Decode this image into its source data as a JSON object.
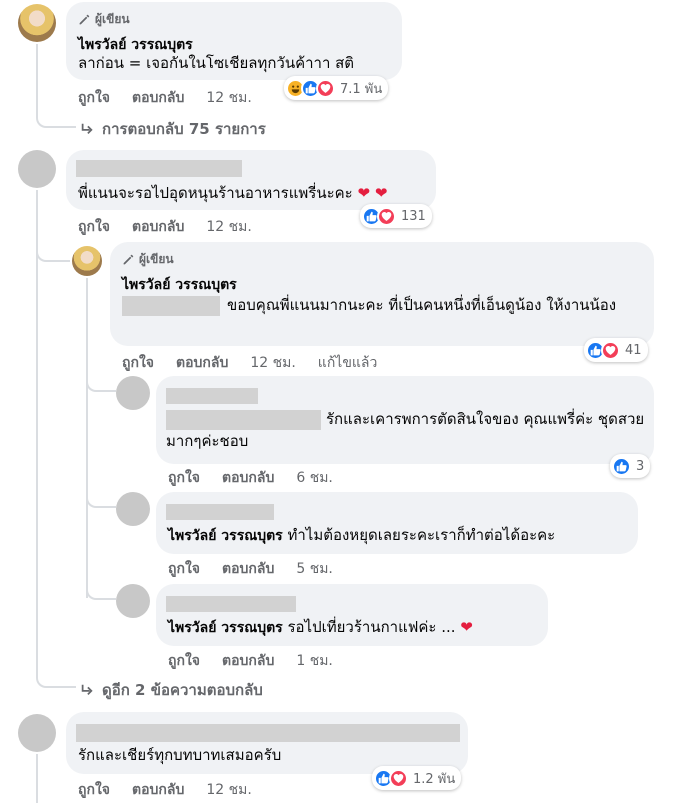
{
  "author_tag": "ผู้เขียน",
  "actions": {
    "like": "ถูกใจ",
    "reply": "ตอบกลับ",
    "edited": "แก้ไขแล้ว"
  },
  "comments": [
    {
      "name": "ไพรวัลย์ วรรณบุตร",
      "text": "ลาก่อน = เจอกันในโซเชียลทุกวันค้าาา สติ",
      "time": "12 ชม.",
      "reaction_count": "7.1 พัน",
      "replies_link": "การตอบกลับ 75 รายการ"
    },
    {
      "text": "พี่แนนจะรอไปอุดหนุนร้านอาหารแพรี่นะคะ",
      "time": "12 ชม.",
      "reaction_count": "131",
      "replies": [
        {
          "name": "ไพรวัลย์ วรรณบุตร",
          "text": "ขอบคุณพี่แนนมากนะคะ ที่เป็นคนหนึ่งที่เอ็นดูน้อง ให้งานน้อง",
          "time": "12 ชม.",
          "reaction_count": "41"
        },
        {
          "text": "รักและเคารพการตัดสินใจของ คุณแพรี่ค่ะ ชุดสวยมากๆค่ะชอบ",
          "time": "6 ชม.",
          "reaction_count": "3"
        },
        {
          "tagged_name": "ไพรวัลย์ วรรณบุตร",
          "text": "ทำไมต้องหยุดเลยระคะเราก็ทำต่อได้อะคะ",
          "time": "5 ชม."
        },
        {
          "tagged_name": "ไพรวัลย์ วรรณบุตร",
          "text": "รอไปเที่ยวร้านกาแฟค่ะ ...",
          "time": "1 ชม."
        }
      ],
      "more_replies_link": "ดูอีก 2 ข้อความตอบกลับ"
    },
    {
      "text": "รักและเชียร์ทุกบทบาทเสมอครับ",
      "time": "12 ชม.",
      "reaction_count": "1.2 พัน"
    }
  ],
  "colors": {
    "like": "#1877f2",
    "love": "#f33e58",
    "bubble": "#f0f2f5",
    "meta": "#65676b"
  }
}
